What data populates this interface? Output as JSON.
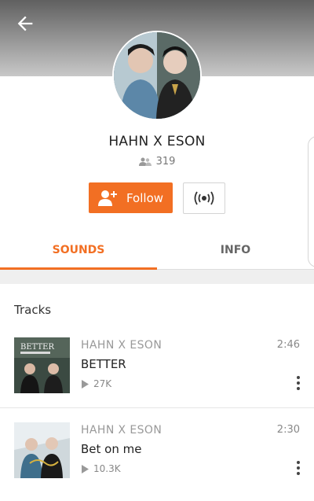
{
  "profile": {
    "name": "HAHN X ESON",
    "followers": "319"
  },
  "actions": {
    "follow_label": "Follow"
  },
  "tabs": [
    {
      "label": "SOUNDS"
    },
    {
      "label": "INFO"
    }
  ],
  "section": {
    "title": "Tracks"
  },
  "tracks": [
    {
      "artist": "HAHN X ESON",
      "title": "BETTER",
      "duration": "2:46",
      "plays": "27K",
      "art_text": "BETTER"
    },
    {
      "artist": "HAHN X ESON",
      "title": "Bet on me",
      "duration": "2:30",
      "plays": "10.3K"
    }
  ],
  "colors": {
    "accent": "#f26f23",
    "header_top": "#606060",
    "header_bottom": "#c8c8c8"
  },
  "icons": [
    "back-arrow-icon",
    "followers-icon",
    "add-user-icon",
    "broadcast-icon",
    "play-icon",
    "more-vertical-icon"
  ]
}
